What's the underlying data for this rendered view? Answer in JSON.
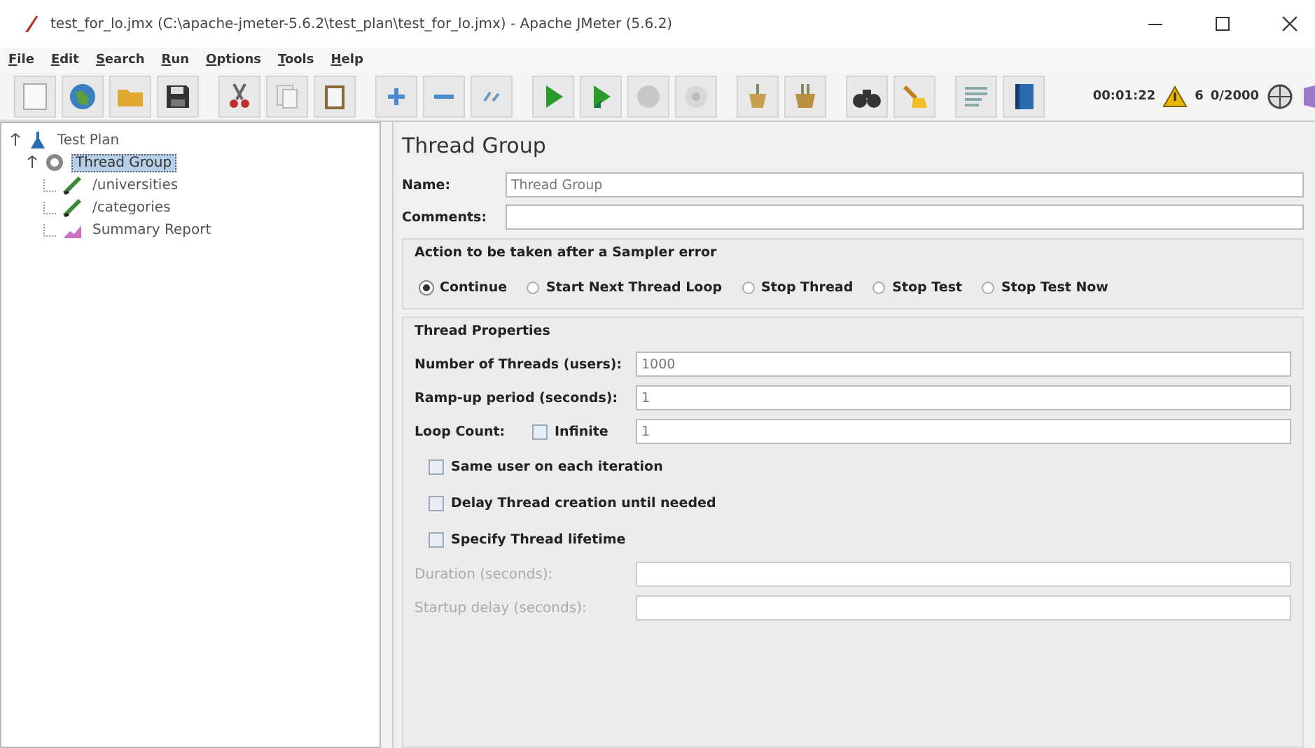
{
  "window": {
    "title": "test_for_lo.jmx (C:\\apache-jmeter-5.6.2\\test_plan\\test_for_lo.jmx) - Apache JMeter (5.6.2)"
  },
  "menu": [
    "File",
    "Edit",
    "Search",
    "Run",
    "Options",
    "Tools",
    "Help"
  ],
  "toolbar_status": {
    "elapsed": "00:01:22",
    "warnings": "6",
    "threads": "0/2000"
  },
  "tree": [
    {
      "label": "Test Plan",
      "kind": "plan",
      "selected": false,
      "expanded": true,
      "children": [
        {
          "label": "Thread Group",
          "kind": "group",
          "selected": true,
          "expanded": true,
          "children": [
            {
              "label": "/universities",
              "kind": "sampler",
              "selected": false
            },
            {
              "label": "/categories",
              "kind": "sampler",
              "selected": false
            },
            {
              "label": "Summary Report",
              "kind": "listener",
              "selected": false
            }
          ]
        }
      ]
    }
  ],
  "editor": {
    "title": "Thread Group",
    "fields": [
      {
        "label": "Name:",
        "value": "Thread Group"
      },
      {
        "label": "Comments:"
      }
    ],
    "error_action": {
      "title": "Action to be taken after a Sampler error",
      "options": [
        {
          "label": "Continue",
          "selected": true
        },
        {
          "label": "Start Next Thread Loop",
          "selected": false
        },
        {
          "label": "Stop Thread",
          "selected": false
        },
        {
          "label": "Stop Test",
          "selected": false
        },
        {
          "label": "Stop Test Now",
          "selected": false
        }
      ]
    },
    "thread_properties": {
      "title": "Thread Properties",
      "rows": [
        {
          "kind": "field",
          "label": "Number of Threads (users):",
          "value": "1000",
          "disabled": false
        },
        {
          "kind": "field",
          "label": "Ramp-up period (seconds):",
          "value": "1",
          "disabled": false
        },
        {
          "kind": "loop",
          "label": "Loop Count:",
          "checkbox": {
            "label": "Infinite",
            "checked": false
          },
          "value": "1",
          "disabled": false
        },
        {
          "kind": "checkbox",
          "label": "Same user on each iteration",
          "checked": false
        },
        {
          "kind": "checkbox",
          "label": "Delay Thread creation until needed",
          "checked": false
        },
        {
          "kind": "checkbox",
          "label": "Specify Thread lifetime",
          "checked": false
        },
        {
          "kind": "field",
          "label": "Duration (seconds):",
          "disabled": true
        },
        {
          "kind": "field",
          "label": "Startup delay (seconds):",
          "disabled": true
        }
      ]
    }
  }
}
